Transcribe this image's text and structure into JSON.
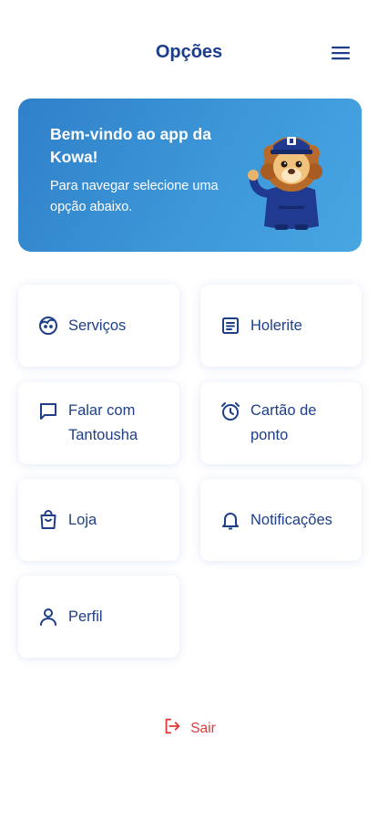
{
  "header": {
    "title": "Opções",
    "menu_icon": "hamburger-menu-icon"
  },
  "banner": {
    "title": "Bem-vindo ao app da Kowa!",
    "subtitle": "Para navegar selecione uma opção abaixo.",
    "illustration": "lion-mascot-in-blue-uniform"
  },
  "menu": {
    "items": [
      {
        "label": "Serviços",
        "icon": "face-icon"
      },
      {
        "label": "Holerite",
        "icon": "document-icon"
      },
      {
        "label": "Falar com Tantousha",
        "icon": "chat-icon"
      },
      {
        "label": "Cartão de ponto",
        "icon": "alarm-clock-icon"
      },
      {
        "label": "Loja",
        "icon": "shopping-bag-icon"
      },
      {
        "label": "Notificações",
        "icon": "bell-icon"
      },
      {
        "label": "Perfil",
        "icon": "user-icon"
      }
    ]
  },
  "logout": {
    "label": "Sair",
    "icon": "logout-icon"
  },
  "colors": {
    "primary": "#1c3d8c",
    "banner_start": "#2f80c9",
    "banner_end": "#48a6e2",
    "danger": "#e23a3a"
  }
}
